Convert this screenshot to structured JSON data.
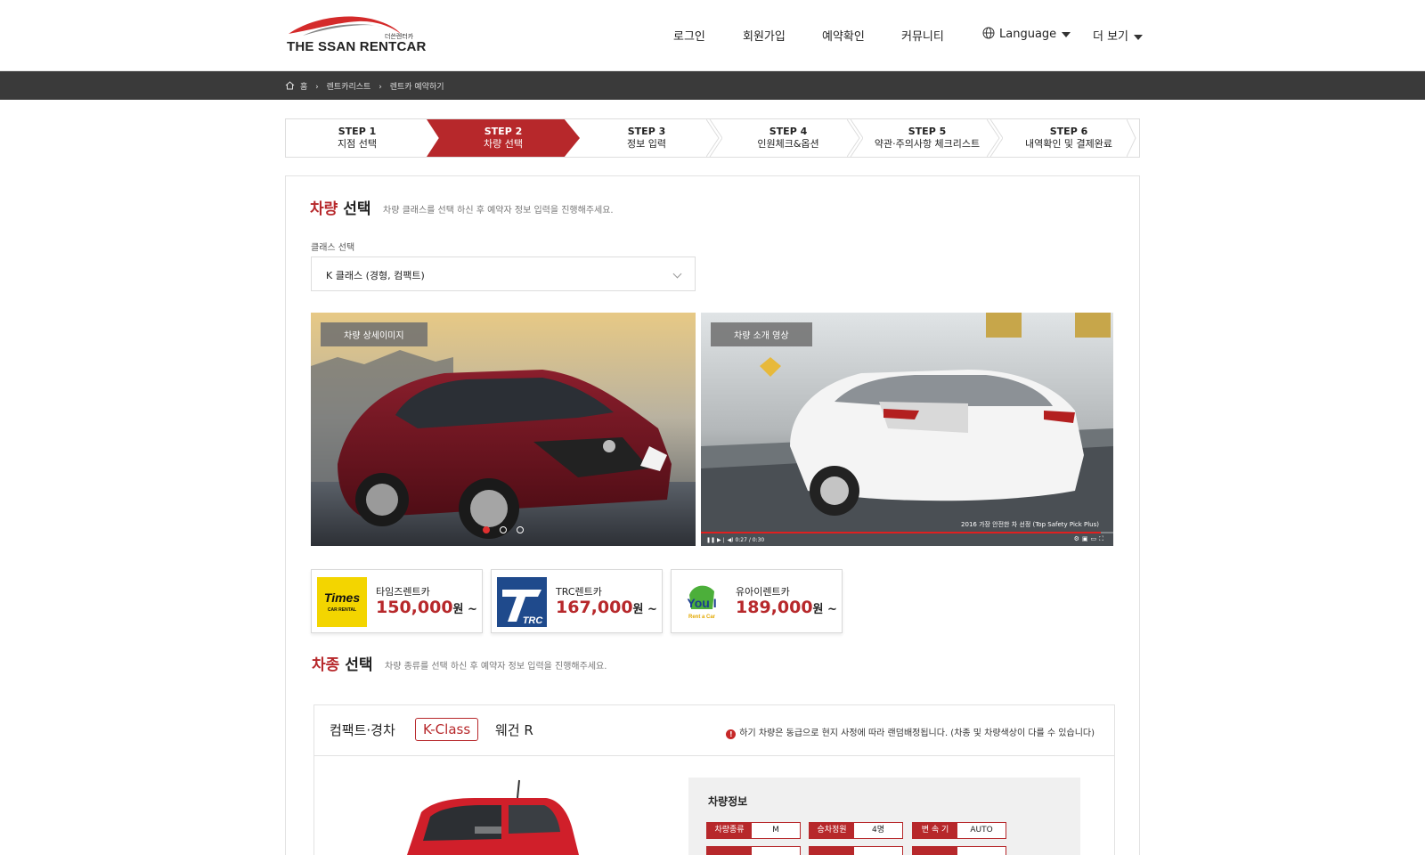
{
  "header": {
    "brand": "THE SSAN RENTCAR",
    "brand_sub": "더쓴렌터카",
    "nav": [
      "로그인",
      "회원가입",
      "예약확인",
      "커뮤니티"
    ],
    "language": "Language",
    "more": "더 보기"
  },
  "breadcrumb": [
    "홈",
    "렌트카리스트",
    "렌트카 예약하기"
  ],
  "steps": [
    {
      "num": "STEP 1",
      "label": "지점 선택"
    },
    {
      "num": "STEP 2",
      "label": "차량 선택"
    },
    {
      "num": "STEP 3",
      "label": "정보 입력"
    },
    {
      "num": "STEP 4",
      "label": "인원체크&옵션"
    },
    {
      "num": "STEP 5",
      "label": "약관·주의사항 체크리스트"
    },
    {
      "num": "STEP 6",
      "label": "내역확인 및 결제완료"
    }
  ],
  "active_step": 2,
  "vehicle_section": {
    "title_red": "차량",
    "title_rest": " 선택",
    "desc": "차량 클래스를 선택 하신 후 예약자 정보 입력을 진행해주세요.",
    "class_label": "클래스 선택",
    "class_value": "K 클래스 (경형, 컴팩트)"
  },
  "media": {
    "detail_tag": "차량 상세이미지",
    "video_tag": "차량 소개 영상",
    "video_caption": "2016 가장 안전한 차 선정 (Top Safety Pick Plus)",
    "video_time": "0:27 / 0:30",
    "slide_count": 3,
    "slide_active": 1
  },
  "companies": [
    {
      "name": "타임즈렌트카",
      "price": "150,000",
      "unit": "원 ~",
      "logo": "times-logo"
    },
    {
      "name": "TRC렌트카",
      "price": "167,000",
      "unit": "원 ~",
      "logo": "trc-logo"
    },
    {
      "name": "유아이렌트카",
      "price": "189,000",
      "unit": "원 ~",
      "logo": "youi-logo"
    }
  ],
  "model_section": {
    "title_red": "차종",
    "title_rest": " 선택",
    "desc": "차량 종류를 선택 하신 후 예약자 정보 입력을 진행해주세요.",
    "category": "컴팩트·경차",
    "active_class": "K-Class",
    "model": "웨건 R",
    "notice": "하기 차량은 동급으로 현지 사정에 따라 랜덤배정됩니다. (차종 및 차량색상이 다를 수 있습니다)"
  },
  "car_info": {
    "title": "차량정보",
    "specs": [
      {
        "key": "차량종류",
        "value": "M"
      },
      {
        "key": "승차정원",
        "value": "4명"
      },
      {
        "key": "변 속 기",
        "value": "AUTO"
      }
    ]
  },
  "colors": {
    "accent": "#b7282b",
    "dark_bar": "#3a3a3a"
  }
}
